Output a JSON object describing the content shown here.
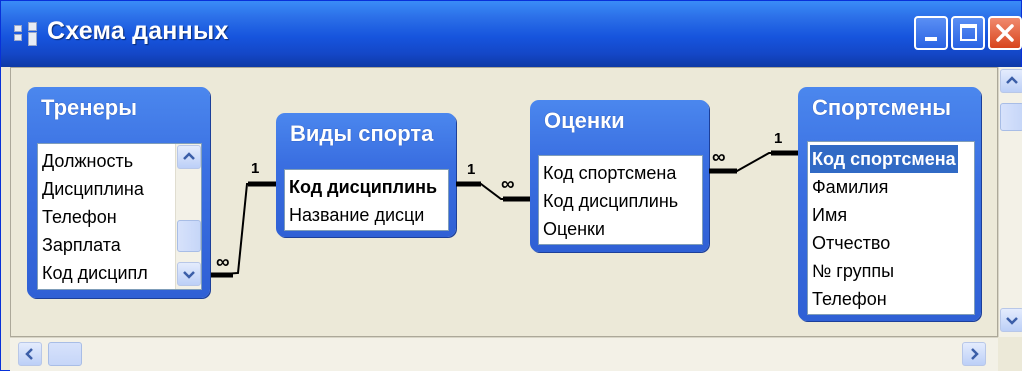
{
  "window": {
    "title": "Схема данных"
  },
  "tables": [
    {
      "title": "Тренеры",
      "fields": [
        {
          "label": "Должность"
        },
        {
          "label": "Дисциплина"
        },
        {
          "label": "Телефон"
        },
        {
          "label": "Зарплата"
        },
        {
          "label": "Код дисципл"
        }
      ]
    },
    {
      "title": "Виды спорта",
      "fields": [
        {
          "label": "Код дисциплинь",
          "key": true
        },
        {
          "label": "Название дисци"
        }
      ]
    },
    {
      "title": "Оценки",
      "fields": [
        {
          "label": "Код спортсмена"
        },
        {
          "label": "Код дисциплинь"
        },
        {
          "label": "Оценки"
        }
      ]
    },
    {
      "title": "Спортсмены",
      "fields": [
        {
          "label": "Код спортсмена",
          "key": true,
          "selected": true
        },
        {
          "label": "Фамилия"
        },
        {
          "label": "Имя"
        },
        {
          "label": "Отчество"
        },
        {
          "label": "№ группы"
        },
        {
          "label": "Телефон"
        }
      ]
    }
  ],
  "relationships": [
    {
      "from": "Виды спорта.Код дисциплинь",
      "to": "Тренеры.Код дисципл",
      "one": "1",
      "many": "∞"
    },
    {
      "from": "Виды спорта.Код дисциплинь",
      "to": "Оценки.Код дисциплинь",
      "one": "1",
      "many": "∞"
    },
    {
      "from": "Спортсмены.Код спортсмена",
      "to": "Оценки.Код спортсмена",
      "one": "1",
      "many": "∞"
    }
  ],
  "colors": {
    "titlebar": "#1654dd",
    "table_header": "#3a6fe1",
    "selection": "#316ac5",
    "client_bg": "#ece9d8"
  },
  "icons": [
    "relationships-window-icon",
    "minimize-icon",
    "maximize-icon",
    "close-icon",
    "scroll-up-icon",
    "scroll-down-icon",
    "scroll-left-icon",
    "scroll-right-icon"
  ]
}
